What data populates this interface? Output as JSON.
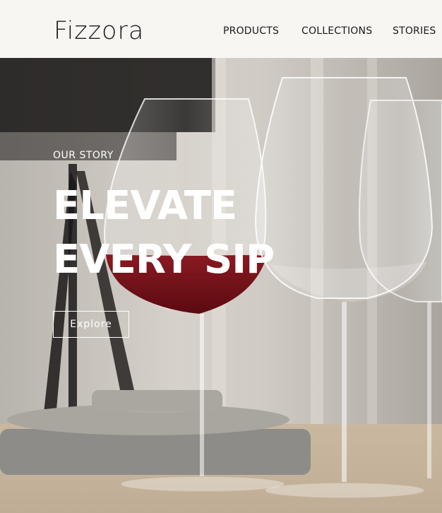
{
  "header": {
    "logo": "Fizzora",
    "nav": [
      "PRODUCTS",
      "COLLECTIONS",
      "STORIES"
    ]
  },
  "hero": {
    "eyebrow": "OUR STORY",
    "headline_line1": "ELEVATE",
    "headline_line2": "EVERY SIP",
    "cta_label": "Explore"
  },
  "colors": {
    "header_bg": "#f7f6f3",
    "text_dark": "#1a1a1a",
    "hero_text": "#ffffff",
    "wine": "#7a1118"
  }
}
